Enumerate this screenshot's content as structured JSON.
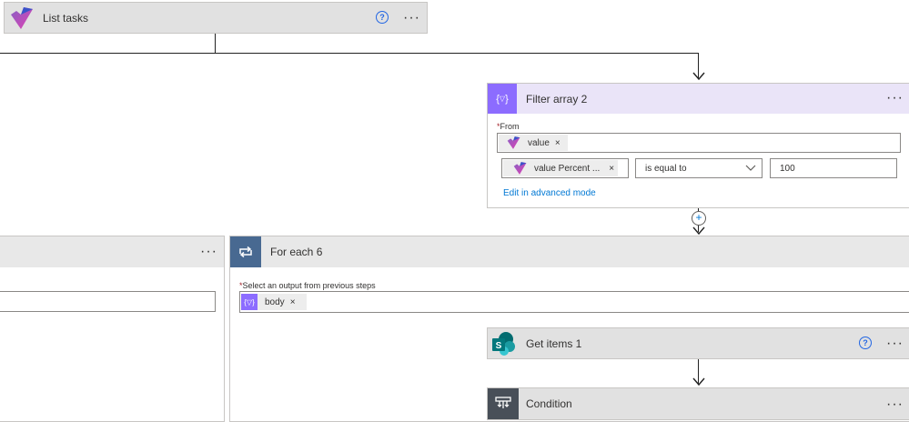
{
  "list_tasks": {
    "title": "List tasks"
  },
  "filter_array": {
    "title": "Filter array 2",
    "from_label": "From",
    "from_token": "value",
    "condition_token": "value Percent ...",
    "operator": "is equal to",
    "value": "100",
    "advanced_link": "Edit in advanced mode",
    "required_mark": "*"
  },
  "for_each": {
    "title": "For each 6",
    "select_label": "Select an output from previous steps",
    "token": "body",
    "required_mark": "*"
  },
  "get_items": {
    "title": "Get items 1"
  },
  "condition": {
    "title": "Condition"
  },
  "common": {
    "more_glyph": "···",
    "remove_glyph": "×",
    "help_glyph": "?"
  },
  "colors": {
    "card_header_gray": "#e1e1e1",
    "filter_header": "#eae4f8",
    "foreach_header": "#e8e8e8",
    "foreach_icon": "#486991",
    "filter_icon": "#8c6cff",
    "condition_icon": "#484f58",
    "sharepoint": "#038387"
  }
}
